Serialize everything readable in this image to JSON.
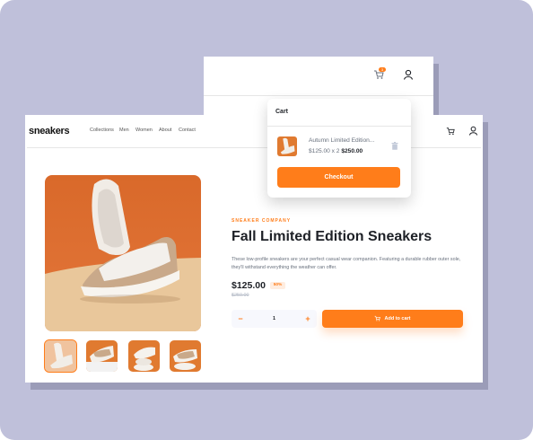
{
  "brand": {
    "logo": "sneakers",
    "accent": "#ff7d1a"
  },
  "nav": {
    "items": [
      "Collections",
      "Men",
      "Women",
      "About",
      "Contact"
    ]
  },
  "header": {
    "cart_badge": "3"
  },
  "product": {
    "company": "SNEAKER COMPANY",
    "title": "Fall Limited Edition Sneakers",
    "description": "These low-profile sneakers are your perfect casual wear companion. Featuring a durable rubber outer sole, they'll withstand everything the weather can offer.",
    "price": "$125.00",
    "discount": "50%",
    "original_price": "$250.00",
    "quantity": "1",
    "add_to_cart_label": "Add to cart"
  },
  "cart": {
    "heading": "Cart",
    "item_name": "Autumn Limited Edition...",
    "item_calc": "$125.00 x 2",
    "item_total": "$250.00",
    "checkout_label": "Checkout"
  },
  "icons": {
    "cart": "cart-icon",
    "user": "user-icon",
    "minus": "minus-icon",
    "plus": "plus-icon",
    "delete": "trash-icon"
  }
}
